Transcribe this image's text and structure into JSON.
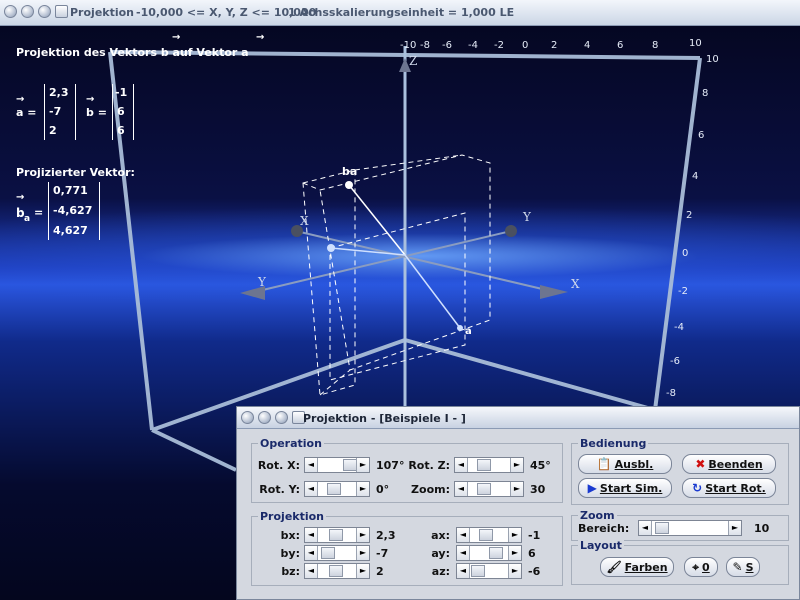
{
  "window": {
    "title": "Projektion",
    "bounds": "-10,000 <= X, Y, Z <= 10,000",
    "scale": "1 Achsskalierungseinheit = 1,000 LE"
  },
  "overlay": {
    "heading": "Projektion des Vektors b auf Vektor a",
    "vec_a_label": "a =",
    "vec_a": [
      "2,3",
      "-7",
      "2"
    ],
    "vec_b_label": "b =",
    "vec_b": [
      "-1",
      "6",
      "6"
    ],
    "proj_heading": "Projizierter Vektor:",
    "proj_label": "b",
    "proj_label_sub": "a",
    "proj_eq": "=",
    "proj_vec": [
      "0,771",
      "-4,627",
      "4,627"
    ]
  },
  "scene": {
    "axis_labels": {
      "x_pos": "X",
      "x_neg": "X",
      "y_pos": "Y",
      "y_neg": "Y",
      "z_pos": "Z"
    },
    "vector_labels": {
      "ba": "ba",
      "a": "a"
    },
    "right_ticks": [
      "10",
      "8",
      "6",
      "4",
      "2",
      "0",
      "-2",
      "-4",
      "-6",
      "-8"
    ],
    "top_ticks": [
      "-10",
      "-8",
      "-6",
      "-4",
      "-2",
      "0",
      "2",
      "4",
      "6",
      "8",
      "10"
    ]
  },
  "dialog": {
    "title": "Projektion - [Beispiele I - ]",
    "operation": {
      "label": "Operation",
      "rot_x_label": "Rot. X:",
      "rot_x_value": "107°",
      "rot_y_label": "Rot. Y:",
      "rot_y_value": "0°",
      "rot_z_label": "Rot. Z:",
      "rot_z_value": "45°",
      "zoom_label": "Zoom:",
      "zoom_value": "30"
    },
    "projektion": {
      "label": "Projektion",
      "bx_label": "bx:",
      "bx_value": "2,3",
      "by_label": "by:",
      "by_value": "-7",
      "bz_label": "bz:",
      "bz_value": "2",
      "ax_label": "ax:",
      "ax_value": "-1",
      "ay_label": "ay:",
      "ay_value": "6",
      "az_label": "az:",
      "az_value": "-6"
    },
    "bedienung": {
      "label": "Bedienung",
      "ausbl": "Ausbl.",
      "beenden": "Beenden",
      "start_sim": "Start Sim.",
      "start_rot": "Start Rot."
    },
    "zoom": {
      "label": "Zoom",
      "bereich_label": "Bereich:",
      "bereich_value": "10"
    },
    "layout": {
      "label": "Layout",
      "farben": "Farben",
      "null": "0",
      "s": "S"
    }
  },
  "colors": {
    "accent": "#1a2a6a",
    "scene_glow": "#2a56e0",
    "dialog_bg": "#d4d8e0"
  }
}
